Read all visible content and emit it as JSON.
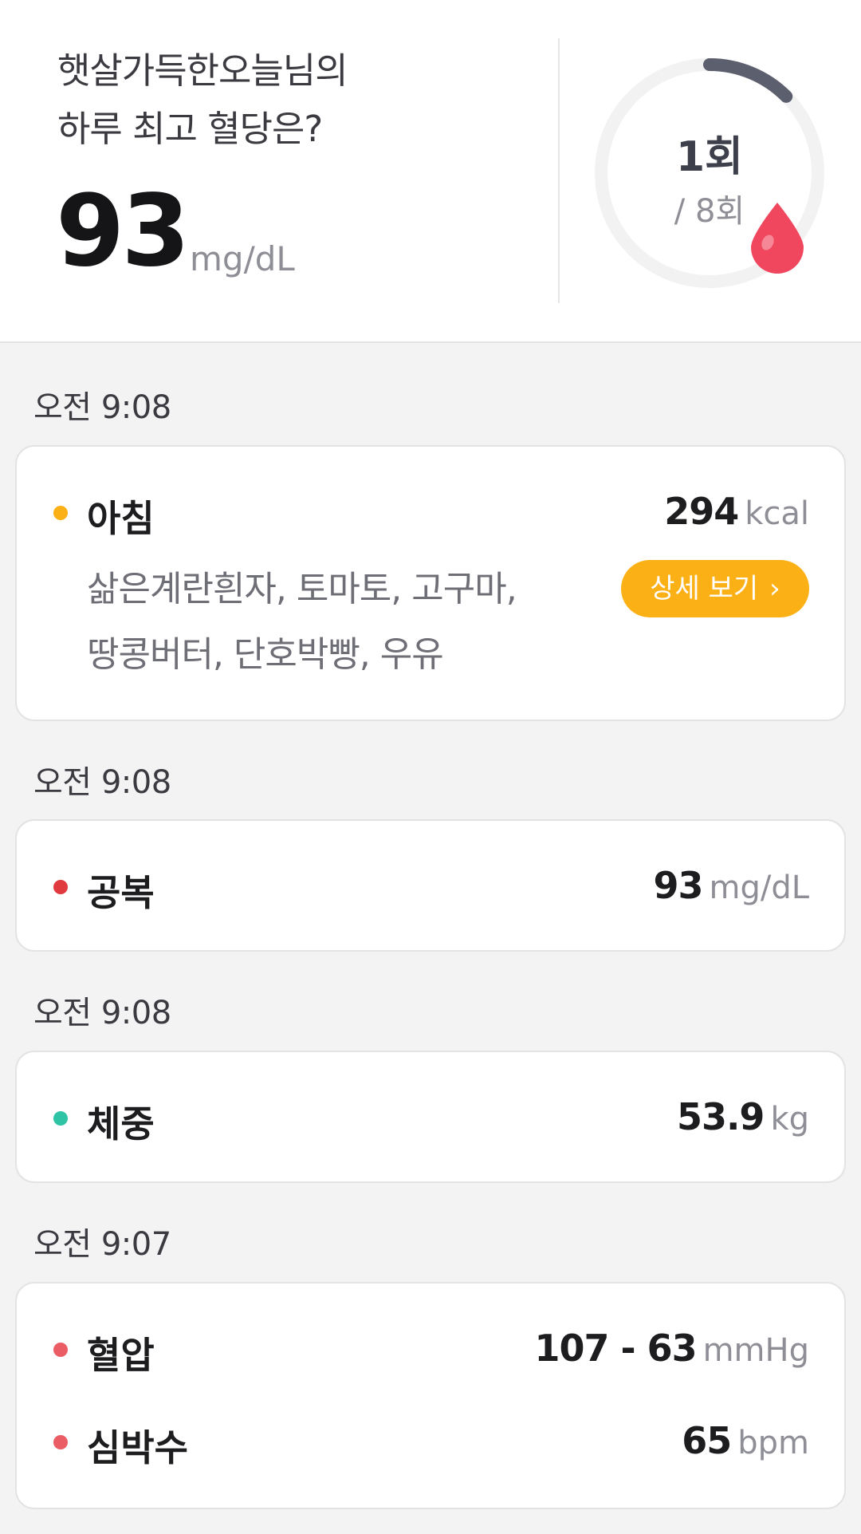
{
  "summary": {
    "greeting_line1": "햇살가득한오늘님의",
    "greeting_line2": "하루 최고 혈당은?",
    "max_glucose": "93",
    "max_glucose_unit": "mg/dL",
    "count_label": "1회",
    "total_label": "/ 8회",
    "progress_fraction": 0.125,
    "track_color": "#f2f2f3",
    "progress_color": "#5c606e",
    "drop_color": "#f0475f"
  },
  "entries": [
    {
      "time": "오전 9:08",
      "type": "meal",
      "title": "아침",
      "dot_color": "#fbb116",
      "value": "294",
      "unit": "kcal",
      "items_line1": "삶은계란흰자, 토마토, 고구마,",
      "items_line2": "땅콩버터, 단호박빵, 우유",
      "button_label": "상세 보기",
      "button_icon": "chevron-right-icon"
    },
    {
      "time": "오전 9:08",
      "type": "glucose",
      "title": "공복",
      "dot_color": "#e0393e",
      "value": "93",
      "unit": "mg/dL"
    },
    {
      "time": "오전 9:08",
      "type": "weight",
      "title": "체중",
      "dot_color": "#2fc3a6",
      "value": "53.9",
      "unit": "kg"
    },
    {
      "time": "오전 9:07",
      "type": "vitals",
      "rows": [
        {
          "title": "혈압",
          "dot_color": "#ea5d64",
          "value": "107 - 63",
          "unit": "mmHg"
        },
        {
          "title": "심박수",
          "dot_color": "#ea5d64",
          "value": "65",
          "unit": "bpm"
        }
      ]
    }
  ]
}
